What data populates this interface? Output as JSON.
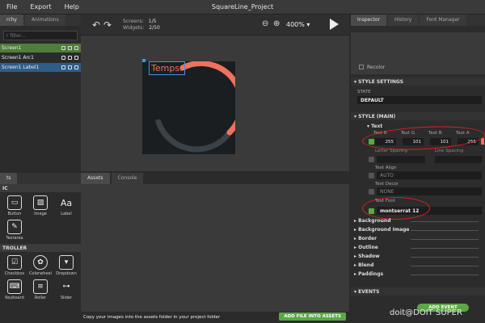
{
  "menubar": {
    "items": [
      "File",
      "Export",
      "Help"
    ],
    "title": "SquareLine_Project"
  },
  "hierarchy": {
    "tabs": [
      "rchy",
      "Animations"
    ],
    "search_placeholder": "r filter...",
    "rows": [
      {
        "label": "Screen1",
        "color": "#4f7d3a"
      },
      {
        "label": "Screen1 Arc1",
        "color": ""
      },
      {
        "label": "Screen1 Label1",
        "color": "#2e5d8a"
      }
    ]
  },
  "widgets": {
    "tab": "ts",
    "basic_header": "IC",
    "basic": [
      {
        "label": "Button",
        "icon": "button-icon",
        "glyph": "▭"
      },
      {
        "label": "Image",
        "icon": "image-icon",
        "glyph": "▨"
      },
      {
        "label": "Label",
        "icon": "label-icon",
        "glyph": "Aa"
      },
      {
        "label": "Textarea",
        "icon": "textarea-icon",
        "glyph": "✎"
      }
    ],
    "controller_header": "TROLLER",
    "controller": [
      {
        "label": "Checkbox",
        "icon": "checkbox-icon",
        "glyph": "☑"
      },
      {
        "label": "Colorwheel",
        "icon": "colorwheel-icon",
        "glyph": "✿"
      },
      {
        "label": "Dropdown",
        "icon": "dropdown-icon",
        "glyph": "▾"
      },
      {
        "label": "Keyboard",
        "icon": "keyboard-icon",
        "glyph": "⌨"
      },
      {
        "label": "Roller",
        "icon": "roller-icon",
        "glyph": "≡"
      },
      {
        "label": "Slider",
        "icon": "slider-icon",
        "glyph": "⊶"
      }
    ]
  },
  "toolbar": {
    "screens_label": "Screens:",
    "screens_value": "1/5",
    "widgets_label": "Widgets:",
    "widgets_value": "2/50",
    "zoom": "400%"
  },
  "canvas": {
    "label_text": "Temps.",
    "arc_color": "#f0715f",
    "track_color": "#3a4248",
    "screen_bg": "#1b1e21"
  },
  "assets": {
    "tabs": [
      "Assets",
      "Console"
    ],
    "footer_text": "Copy your images into the assets folder in your project folder",
    "add_button": "ADD FILE INTO ASSETS"
  },
  "inspector": {
    "tabs": [
      "Inspector",
      "History",
      "Font Manager"
    ],
    "recolor": "Recolor",
    "style_settings": "STYLE SETTINGS",
    "state_label": "STATE",
    "state_value": "DEFAULT",
    "style_main": "STYLE (MAIN)",
    "text_header": "Text",
    "text_r_label": "Text R",
    "text_g_label": "Text G",
    "text_b_label": "Text B",
    "text_a_label": "Text A",
    "text_r": "255",
    "text_g": "101",
    "text_b": "101",
    "text_a": "255",
    "letter_spacing": "Letter Spacing",
    "line_spacing": "Line Spacing",
    "text_align": "Text Align",
    "text_align_value": "AUTO",
    "text_decor": "Text Decor",
    "text_decor_value": "NONE",
    "text_font": "Text Font",
    "text_font_value": "montserrat 12",
    "sections": [
      "Background",
      "Background Image",
      "Border",
      "Outline",
      "Shadow",
      "Blend",
      "Paddings"
    ],
    "events": "EVENTS",
    "add_event": "ADD EVENT"
  },
  "watermark": "doit@DOIT SUPER"
}
